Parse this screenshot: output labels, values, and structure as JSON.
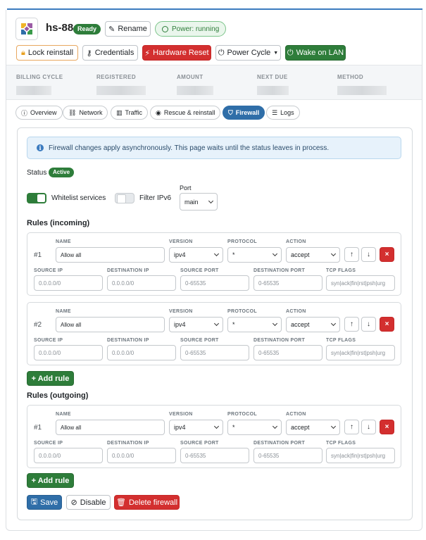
{
  "header": {
    "server_name": "hs-88",
    "status_badge": "Ready",
    "rename_label": "Rename",
    "power_status": "Power: running"
  },
  "actions": {
    "lock_reinstall": "Lock reinstall",
    "credentials": "Credentials",
    "hardware_reset": "Hardware Reset",
    "power_cycle": "Power Cycle",
    "wake_on_lan": "Wake on LAN"
  },
  "billing": {
    "billing_cycle": "BILLING CYCLE",
    "registered": "REGISTERED",
    "amount": "AMOUNT",
    "next_due": "NEXT DUE",
    "method": "METHOD"
  },
  "tabs": [
    {
      "label": "Overview",
      "icon": "info-icon"
    },
    {
      "label": "Network",
      "icon": "network-icon"
    },
    {
      "label": "Traffic",
      "icon": "chart-icon"
    },
    {
      "label": "Rescue & reinstall",
      "icon": "rescue-icon"
    },
    {
      "label": "Firewall",
      "icon": "shield-icon",
      "active": true
    },
    {
      "label": "Logs",
      "icon": "list-icon"
    }
  ],
  "firewall": {
    "info_text": "Firewall changes apply asynchronously. This page waits until the status leaves in process.",
    "status_label": "Status",
    "status_value": "Active",
    "whitelist_label": "Whitelist services",
    "whitelist_on": true,
    "filter_ipv6_label": "Filter IPv6",
    "filter_ipv6_on": false,
    "port_label": "Port",
    "port_value": "main",
    "incoming_title": "Rules (incoming)",
    "outgoing_title": "Rules (outgoing)",
    "add_rule_label": "+ Add rule",
    "save_label": "Save",
    "disable_label": "Disable",
    "delete_label": "Delete firewall"
  },
  "field_labels": {
    "name": "NAME",
    "version": "VERSION",
    "protocol": "PROTOCOL",
    "action": "ACTION",
    "source_ip": "SOURCE IP",
    "destination_ip": "DESTINATION IP",
    "source_port": "SOURCE PORT",
    "destination_port": "DESTINATION PORT",
    "tcp_flags": "TCP FLAGS"
  },
  "placeholders": {
    "source_ip": "0.0.0.0/0",
    "destination_ip": "0.0.0.0/0",
    "source_port": "0-65535",
    "destination_port": "0-65535",
    "tcp_flags": "syn|ack|fin|rst|psh|urg"
  },
  "incoming_rules": [
    {
      "num": "#1",
      "name": "Allow all",
      "version": "ipv4",
      "protocol": "*",
      "action": "accept"
    },
    {
      "num": "#2",
      "name": "Allow all",
      "version": "ipv4",
      "protocol": "*",
      "action": "accept"
    }
  ],
  "outgoing_rules": [
    {
      "num": "#1",
      "name": "Allow all",
      "version": "ipv4",
      "protocol": "*",
      "action": "accept"
    }
  ],
  "colors": {
    "accent": "#2f6ea8",
    "success": "#2e7d3a",
    "danger": "#d32f2f"
  }
}
